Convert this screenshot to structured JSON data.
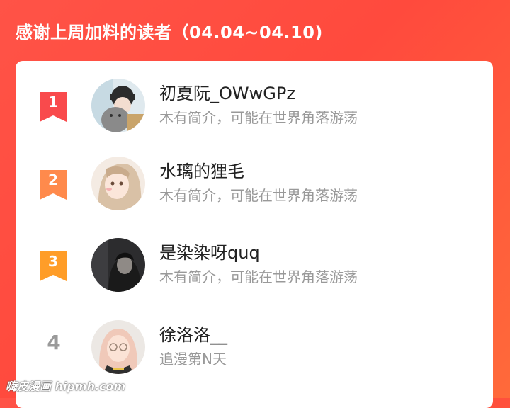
{
  "header": {
    "title": "感谢上周加料的读者（04.04~04.10)"
  },
  "colors": {
    "background": "#ff5347",
    "rank1": "#f94a4c",
    "rank2": "#ff8a4c",
    "rank3": "#ff9d28",
    "rank_plain": "#9a9a9a"
  },
  "readers": [
    {
      "rank": "1",
      "name": "初夏阮_OWwGPz",
      "bio": "木有简介，可能在世界角落游荡",
      "avatar_icon": "avatar-girl-cap-cat"
    },
    {
      "rank": "2",
      "name": "水璃的狸毛",
      "bio": "木有简介，可能在世界角落游荡",
      "avatar_icon": "avatar-anime-girl"
    },
    {
      "rank": "3",
      "name": "是染染呀quq",
      "bio": "木有简介，可能在世界角落游荡",
      "avatar_icon": "avatar-dark-figure"
    },
    {
      "rank": "4",
      "name": "徐洛洛__",
      "bio": "追漫第N天",
      "avatar_icon": "avatar-girl-glasses"
    }
  ],
  "watermark": {
    "text": "嗨皮漫画 hipmh.com"
  }
}
